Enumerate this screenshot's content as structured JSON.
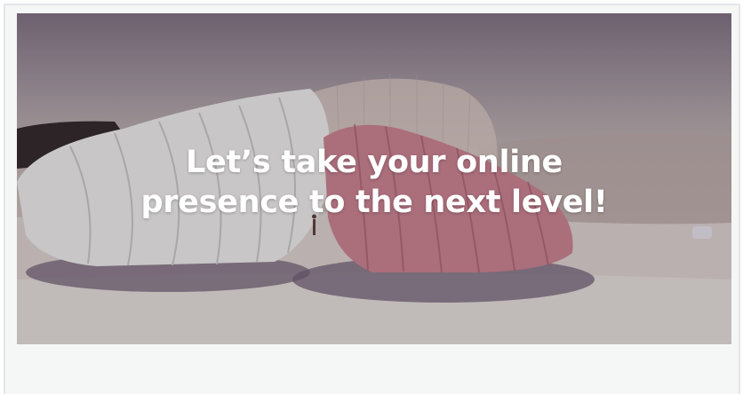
{
  "hero": {
    "line1": "Let’s take your online",
    "line2": "presence to the next level!"
  },
  "colors": {
    "frame_border": "#e4e6e8",
    "frame_background": "#f5f6f6",
    "headline_text": "#ffffff",
    "pink_shell": "#c97f8e",
    "white_shell": "#ecebeb"
  },
  "icons": {
    "corner_badge": "image-badge-icon"
  }
}
